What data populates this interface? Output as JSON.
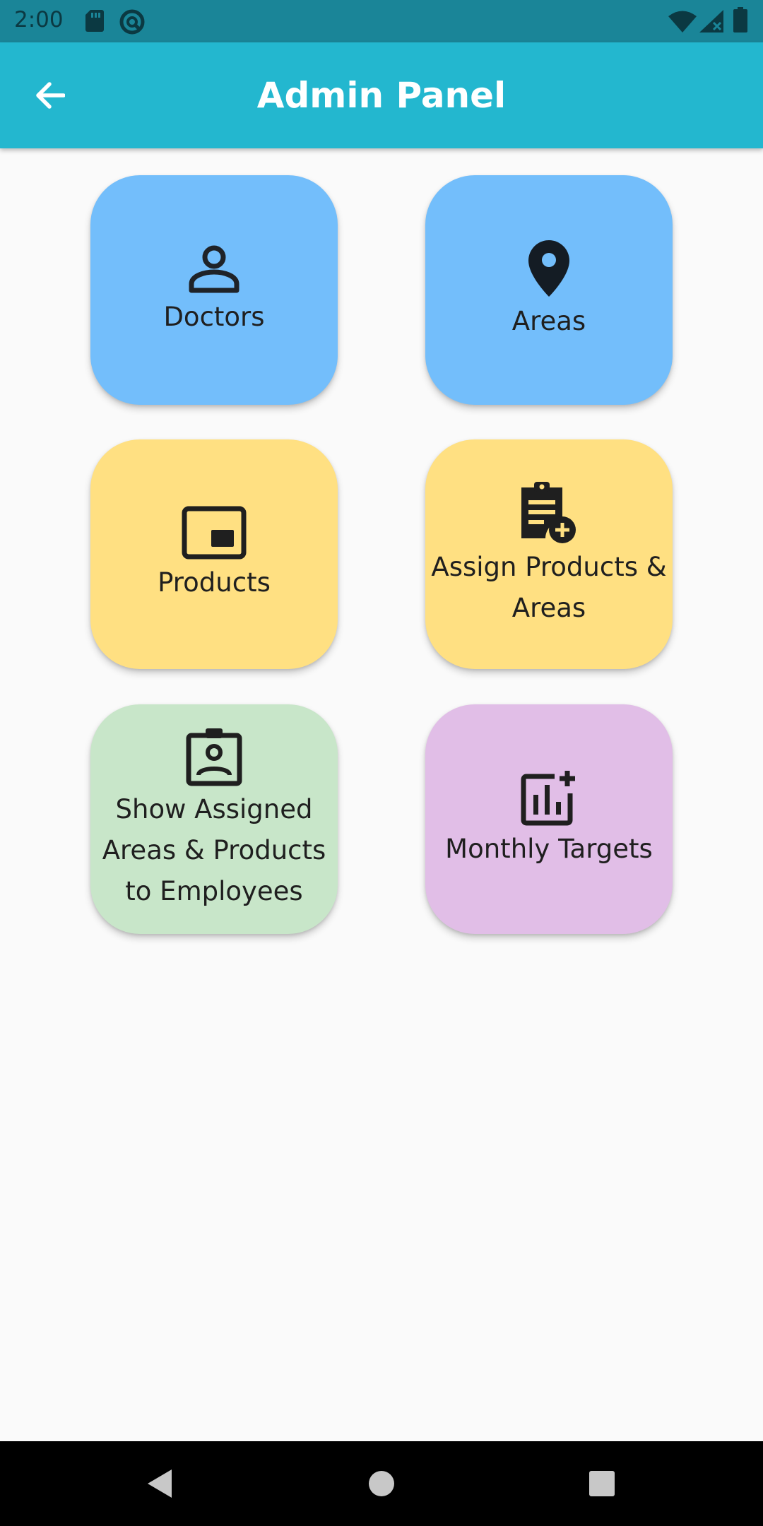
{
  "status_bar": {
    "time": "2:00",
    "icons": [
      "sd-card-icon",
      "sync-icon",
      "wifi-icon",
      "signal-icon",
      "battery-icon"
    ]
  },
  "app_bar": {
    "title": "Admin Panel",
    "back_icon": "arrow-back-icon",
    "color": "#23b7cf"
  },
  "tiles": [
    {
      "label": "Doctors",
      "icon": "person-icon",
      "color": "#73befb"
    },
    {
      "label": "Areas",
      "icon": "location-pin-icon",
      "color": "#73befb"
    },
    {
      "label": "Products",
      "icon": "picture-in-picture-icon",
      "color": "#ffe082"
    },
    {
      "label": "Assign Products & Areas",
      "icon": "clipboard-add-icon",
      "color": "#ffe082"
    },
    {
      "label": "Show Assigned Areas & Products to Employees",
      "icon": "badge-icon",
      "color": "#c8e6c9"
    },
    {
      "label": "Monthly Targets",
      "icon": "add-chart-icon",
      "color": "#e1bee7"
    }
  ],
  "nav_bar": {
    "icons": [
      "back-triangle-icon",
      "home-circle-icon",
      "recents-square-icon"
    ]
  }
}
